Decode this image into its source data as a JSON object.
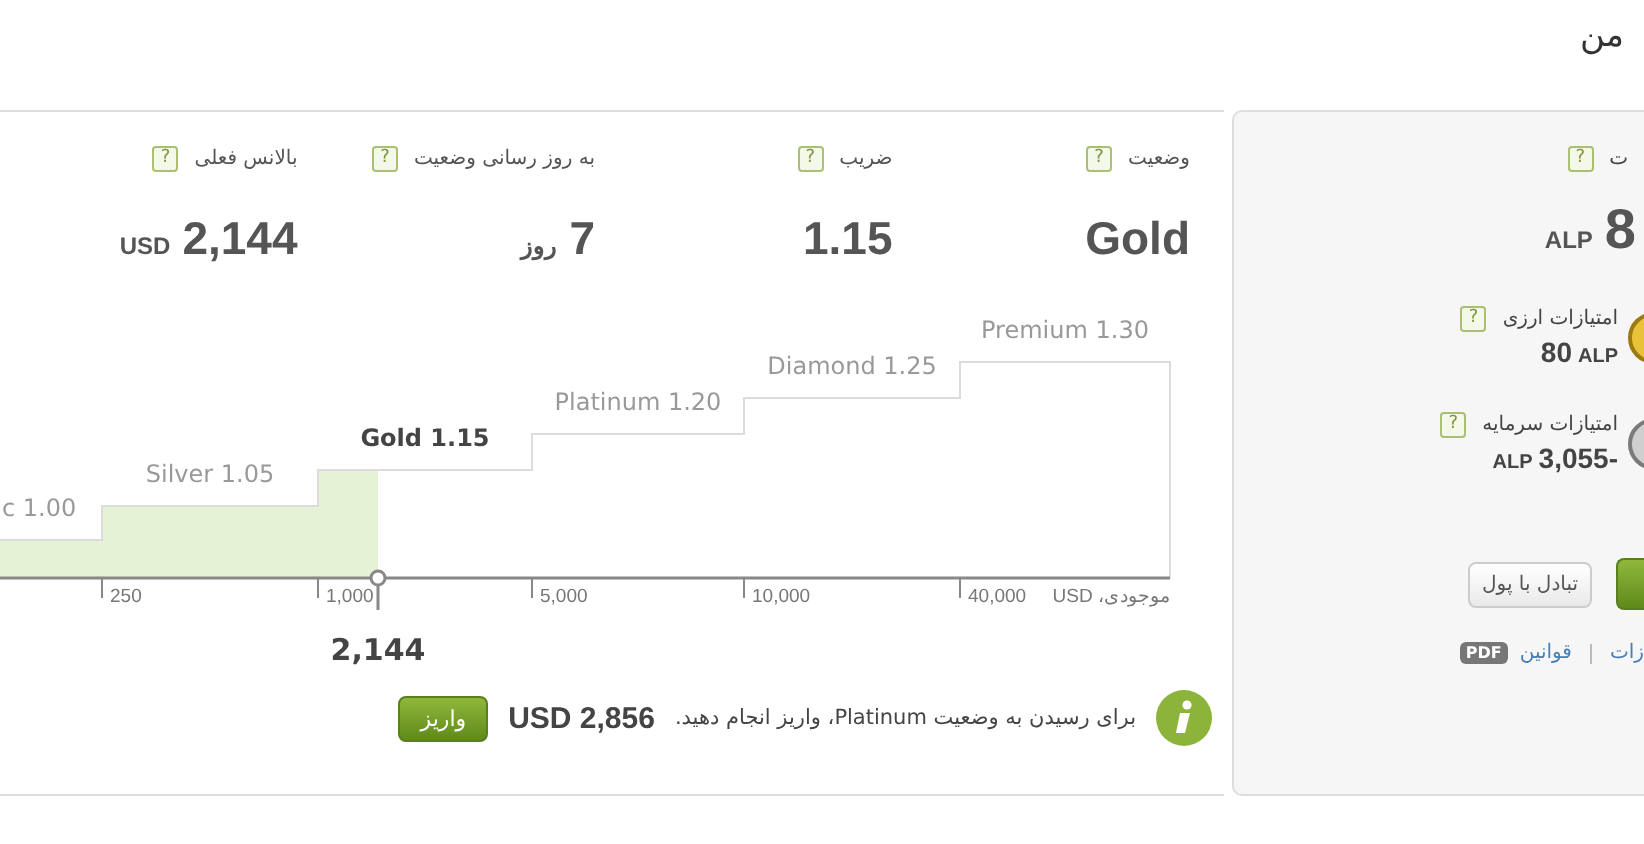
{
  "header": {
    "title": "من"
  },
  "stats": [
    {
      "label": "وضعیت",
      "help": "?",
      "value": "Gold"
    },
    {
      "label": "ضریب",
      "help": "?",
      "value": "1.15"
    },
    {
      "label": "به روز رسانی وضعیت",
      "help": "?",
      "value": "7",
      "unit": "روز"
    },
    {
      "label": "بالانس فعلی",
      "help": "?",
      "value": "2,144",
      "unit": "USD"
    }
  ],
  "chart": {
    "tiers": [
      {
        "label": "c 1.00",
        "selected": false
      },
      {
        "label": "Silver 1.05",
        "selected": false
      },
      {
        "label": "Gold 1.15",
        "selected": true
      },
      {
        "label": "Platinum 1.20",
        "selected": false
      },
      {
        "label": "Diamond 1.25",
        "selected": false
      },
      {
        "label": "Premium 1.30",
        "selected": false
      }
    ],
    "ticks": [
      "40,000",
      "10,000",
      "5,000",
      "1,000",
      "250"
    ],
    "axis_label": "موجودی، USD",
    "marker": "2,144"
  },
  "info": {
    "text": "برای رسیدن به وضعیت Platinum، واریز انجام دهید.",
    "amount": "USD 2,856",
    "button": "واریز"
  },
  "side": {
    "label": "ت",
    "help": "?",
    "value": "8",
    "unit": "ALP",
    "rows": [
      {
        "label": "امتیازات ارزی",
        "help": "?",
        "parts": [
          {
            "text": "ALP",
            "kind": "unit"
          },
          {
            "text": "80",
            "kind": "number"
          }
        ],
        "kind": "gold"
      },
      {
        "label": "امتیازات سرمایه",
        "help": "?",
        "parts": [
          {
            "text": "3,055-",
            "kind": "number"
          },
          {
            "text": "ALP",
            "kind": "unit"
          }
        ],
        "kind": "silver"
      }
    ],
    "buttons": [
      {
        "kind": "primary"
      },
      {
        "label": "تبادل با پول",
        "kind": "secondary"
      }
    ],
    "links": [
      {
        "label": "زات"
      },
      {
        "label": "قوانین",
        "badge": "PDF"
      }
    ]
  }
}
